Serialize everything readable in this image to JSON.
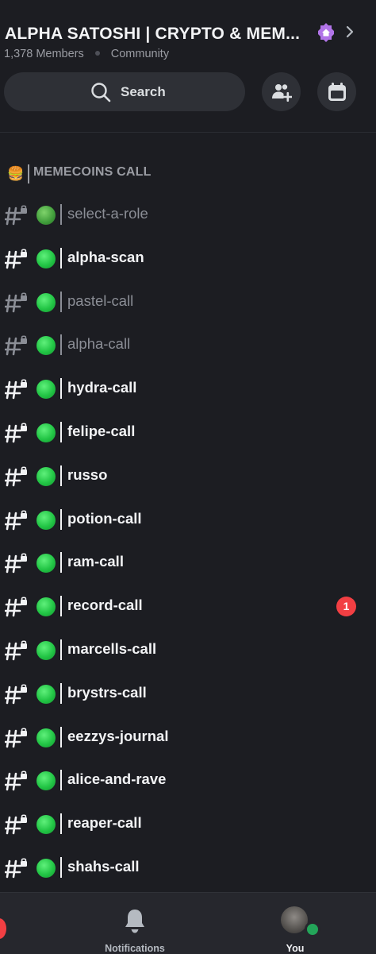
{
  "header": {
    "server_name": "ALPHA SATOSHI | CRYPTO & MEM...",
    "members": "1,378 Members",
    "server_type": "Community",
    "boost_icon": "boost-house-icon",
    "chevron_icon": "chevron-right-icon"
  },
  "search": {
    "label": "Search",
    "icon": "search-icon"
  },
  "actions": {
    "invite_icon": "add-member-icon",
    "events_icon": "calendar-icon"
  },
  "category": {
    "emoji": "🍔",
    "label": "MEMECOINS CALL"
  },
  "channels": [
    {
      "name": "select-a-role",
      "state": "muted",
      "icon": "globe"
    },
    {
      "name": "alpha-scan",
      "state": "unread",
      "icon": "green-circle"
    },
    {
      "name": "pastel-call",
      "state": "muted",
      "icon": "green-circle"
    },
    {
      "name": "alpha-call",
      "state": "muted",
      "icon": "green-circle"
    },
    {
      "name": "hydra-call",
      "state": "unread",
      "icon": "green-circle"
    },
    {
      "name": "felipe-call",
      "state": "unread",
      "icon": "green-circle"
    },
    {
      "name": "russo",
      "state": "unread",
      "icon": "green-circle"
    },
    {
      "name": "potion-call",
      "state": "unread",
      "icon": "green-circle"
    },
    {
      "name": "ram-call",
      "state": "unread",
      "icon": "green-circle"
    },
    {
      "name": "record-call",
      "state": "unread",
      "icon": "green-circle",
      "mentions": "1"
    },
    {
      "name": "marcells-call",
      "state": "unread",
      "icon": "green-circle"
    },
    {
      "name": "brystrs-call",
      "state": "unread",
      "icon": "green-circle"
    },
    {
      "name": "eezzys-journal",
      "state": "unread",
      "icon": "green-circle"
    },
    {
      "name": "alice-and-rave",
      "state": "unread",
      "icon": "green-circle"
    },
    {
      "name": "reaper-call",
      "state": "unread",
      "icon": "green-circle"
    },
    {
      "name": "shahs-call",
      "state": "unread",
      "icon": "green-circle"
    }
  ],
  "bottom_nav": {
    "notifications_label": "Notifications",
    "you_label": "You",
    "notifications_icon": "bell-icon",
    "you_icon": "avatar",
    "status_color": "#23a559"
  },
  "colors": {
    "mention_badge": "#f23f43",
    "muted_text": "#8b8e96",
    "background": "#1c1d22"
  }
}
